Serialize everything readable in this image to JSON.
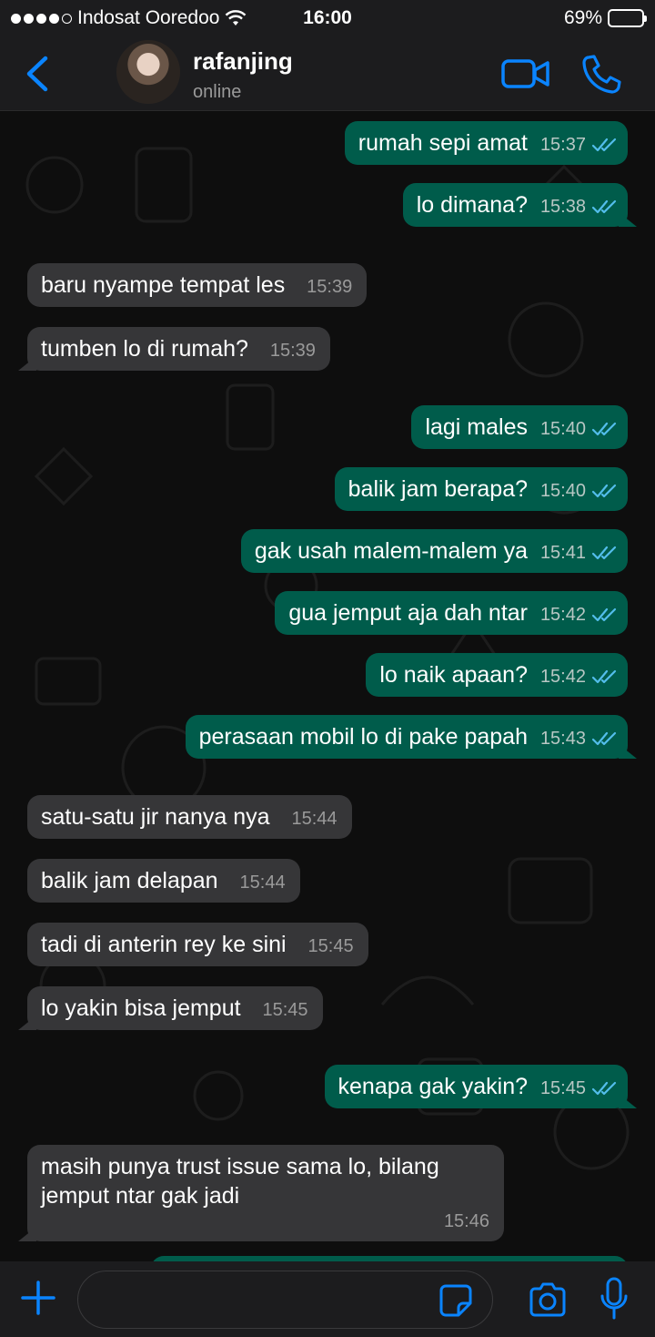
{
  "status_bar": {
    "carrier": "Indosat Ooredoo",
    "time": "16:00",
    "battery": "69%",
    "battery_level": 0.69
  },
  "header": {
    "name": "rafanjing",
    "status": "online"
  },
  "messages": [
    {
      "dir": "out",
      "text": "rumah sepi amat",
      "time": "15:37"
    },
    {
      "dir": "out",
      "text": "lo dimana?",
      "time": "15:38"
    },
    {
      "dir": "in",
      "text": "baru nyampe tempat les",
      "time": "15:39"
    },
    {
      "dir": "in",
      "text": "tumben lo di rumah?",
      "time": "15:39"
    },
    {
      "dir": "out",
      "text": "lagi males",
      "time": "15:40"
    },
    {
      "dir": "out",
      "text": "balik jam berapa?",
      "time": "15:40"
    },
    {
      "dir": "out",
      "text": "gak usah malem-malem ya",
      "time": "15:41"
    },
    {
      "dir": "out",
      "text": "gua jemput aja dah ntar",
      "time": "15:42"
    },
    {
      "dir": "out",
      "text": "lo naik apaan?",
      "time": "15:42"
    },
    {
      "dir": "out",
      "text": "perasaan mobil lo di pake papah",
      "time": "15:43"
    },
    {
      "dir": "in",
      "text": "satu-satu jir nanya nya",
      "time": "15:44"
    },
    {
      "dir": "in",
      "text": "balik jam delapan",
      "time": "15:44"
    },
    {
      "dir": "in",
      "text": "tadi di anterin rey ke sini",
      "time": "15:45"
    },
    {
      "dir": "in",
      "text": "lo yakin bisa jemput",
      "time": "15:45"
    },
    {
      "dir": "out",
      "text": "kenapa gak yakin?",
      "time": "15:45"
    },
    {
      "dir": "in",
      "text": "masih punya trust issue sama lo, bilang jemput ntar gak jadi",
      "time": "15:46"
    }
  ],
  "input": {
    "value": "",
    "placeholder": ""
  },
  "icons": {
    "back": "chevron-left-icon",
    "video": "video-camera-icon",
    "call": "phone-icon",
    "plus": "plus-icon",
    "sticker": "sticker-icon",
    "camera": "camera-icon",
    "mic": "microphone-icon",
    "read": "double-check-icon"
  },
  "colors": {
    "accent": "#0a84ff",
    "outgoing_bubble": "#005c4b",
    "incoming_bubble": "#363638",
    "read_tick": "#53bdeb"
  }
}
